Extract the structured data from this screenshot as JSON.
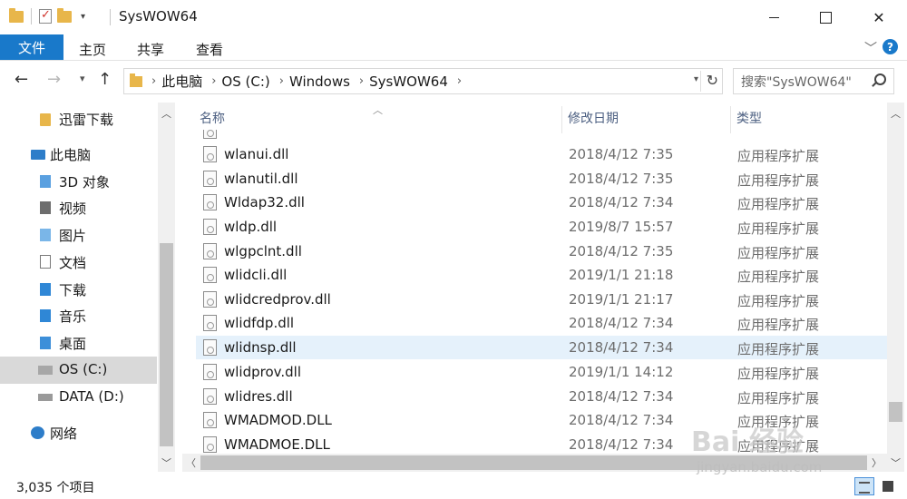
{
  "window": {
    "title": "SysWOW64"
  },
  "ribbon": {
    "file_tab": "文件",
    "tabs": [
      "主页",
      "共享",
      "查看"
    ]
  },
  "address": {
    "crumbs": [
      "此电脑",
      "OS (C:)",
      "Windows",
      "SysWOW64"
    ],
    "search_placeholder": "搜索\"SysWOW64\""
  },
  "sidebar": {
    "items": [
      {
        "label": "迅雷下载",
        "icon": "folder-icon"
      },
      {
        "label": "此电脑",
        "icon": "computer-icon"
      },
      {
        "label": "3D 对象",
        "icon": "3d-objects-icon"
      },
      {
        "label": "视频",
        "icon": "videos-icon"
      },
      {
        "label": "图片",
        "icon": "pictures-icon"
      },
      {
        "label": "文档",
        "icon": "documents-icon"
      },
      {
        "label": "下载",
        "icon": "downloads-icon"
      },
      {
        "label": "音乐",
        "icon": "music-icon"
      },
      {
        "label": "桌面",
        "icon": "desktop-icon"
      },
      {
        "label": "OS (C:)",
        "icon": "drive-c-icon"
      },
      {
        "label": "DATA (D:)",
        "icon": "drive-d-icon"
      },
      {
        "label": "网络",
        "icon": "network-icon"
      }
    ]
  },
  "list": {
    "columns": [
      "名称",
      "修改日期",
      "类型"
    ],
    "rows": [
      {
        "name": "wlanui.dll",
        "date": "2018/4/12 7:35",
        "type": "应用程序扩展"
      },
      {
        "name": "wlanutil.dll",
        "date": "2018/4/12 7:35",
        "type": "应用程序扩展"
      },
      {
        "name": "Wldap32.dll",
        "date": "2018/4/12 7:34",
        "type": "应用程序扩展"
      },
      {
        "name": "wldp.dll",
        "date": "2019/8/7 15:57",
        "type": "应用程序扩展"
      },
      {
        "name": "wlgpclnt.dll",
        "date": "2018/4/12 7:35",
        "type": "应用程序扩展"
      },
      {
        "name": "wlidcli.dll",
        "date": "2019/1/1 21:18",
        "type": "应用程序扩展"
      },
      {
        "name": "wlidcredprov.dll",
        "date": "2019/1/1 21:17",
        "type": "应用程序扩展"
      },
      {
        "name": "wlidfdp.dll",
        "date": "2018/4/12 7:34",
        "type": "应用程序扩展"
      },
      {
        "name": "wlidnsp.dll",
        "date": "2018/4/12 7:34",
        "type": "应用程序扩展"
      },
      {
        "name": "wlidprov.dll",
        "date": "2019/1/1 14:12",
        "type": "应用程序扩展"
      },
      {
        "name": "wlidres.dll",
        "date": "2018/4/12 7:34",
        "type": "应用程序扩展"
      },
      {
        "name": "WMADMOD.DLL",
        "date": "2018/4/12 7:34",
        "type": "应用程序扩展"
      },
      {
        "name": "WMADMOE.DLL",
        "date": "2018/4/12 7:34",
        "type": "应用程序扩展"
      }
    ]
  },
  "status": {
    "item_count": "3,035 个项目"
  },
  "watermark": {
    "main": "Bai 经验",
    "sub": "jingyan.baidu.com"
  },
  "colors": {
    "accent": "#1979ca",
    "row_hover": "#e5f1fb",
    "nav_selected": "#d9d9d9",
    "header_text": "#4d6082"
  }
}
